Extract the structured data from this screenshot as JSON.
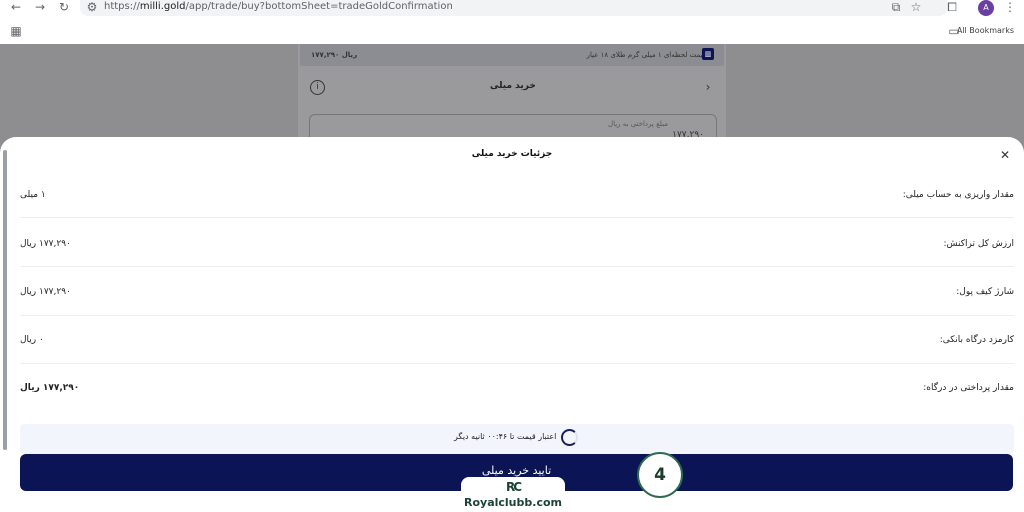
{
  "browser": {
    "url_prefix": "https://",
    "url_domain": "milli.gold",
    "url_path": "/app/trade/buy?bottomSheet=tradeGoldConfirmation",
    "bookmarks_label": "All Bookmarks",
    "profile_initial": "A"
  },
  "background_page": {
    "price_text": "قیمت لحظه‌ای ۱ میلی گرم طلای ۱۸ عیار",
    "price_value": "۱۷۷,۲۹۰ ریال",
    "page_title": "خرید میلی",
    "input_label": "مبلغ پرداختی به ریال",
    "input_value": "۱۷۷,۲۹۰"
  },
  "sheet": {
    "title": "جزئیات خرید میلی",
    "rows": [
      {
        "label": "مقدار واریزی به حساب میلی:",
        "value": "۱ میلی"
      },
      {
        "label": "ارزش کل تراکنش:",
        "value": "۱۷۷,۲۹۰ ریال"
      },
      {
        "label": "شارژ کیف پول:",
        "value": "۱۷۷,۲۹۰ ریال"
      },
      {
        "label": "کارمزد درگاه بانکی:",
        "value": "۰ ریال"
      },
      {
        "label": "مقدار پرداختی در درگاه:",
        "value": "۱۷۷,۲۹۰ ریال"
      }
    ],
    "timer_text": "اعتبار قیمت تا ۰۰:۴۶ ثانیه دیگر",
    "confirm_label": "تایید خرید میلی"
  },
  "overlay": {
    "step_number": "4",
    "watermark_mark": "RC",
    "watermark_text": "Royalclubb.com"
  },
  "colors": {
    "primary": "#0b1454",
    "step_border": "#2e6b4f"
  }
}
